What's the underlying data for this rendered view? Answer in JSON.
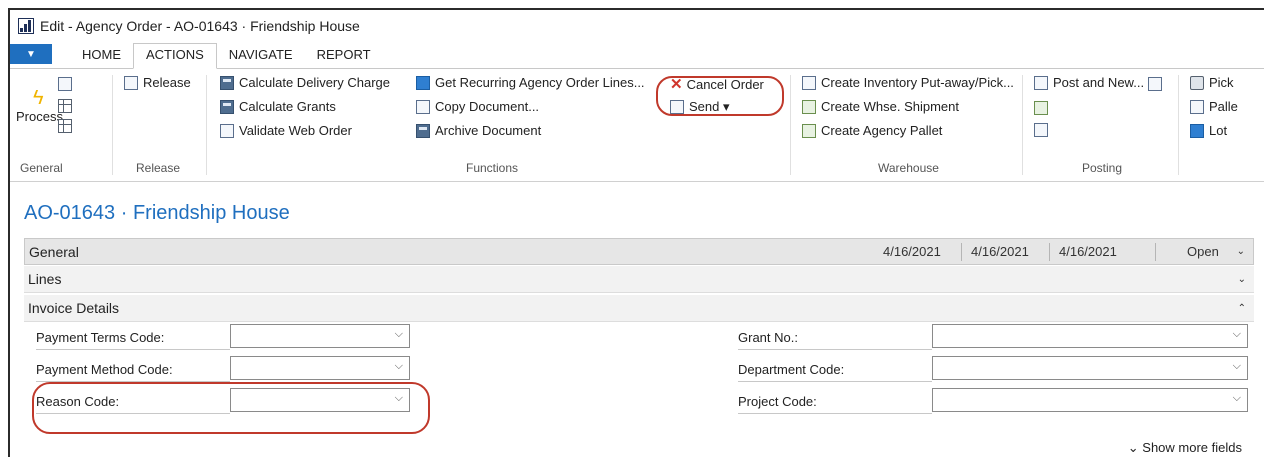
{
  "window": {
    "title": "Edit - Agency Order - AO-01643 · Friendship House"
  },
  "tabs": [
    "HOME",
    "ACTIONS",
    "NAVIGATE",
    "REPORT"
  ],
  "ribbon": {
    "general": {
      "process": "Process",
      "group": "General"
    },
    "release": {
      "release": "Release",
      "group": "Release"
    },
    "functions": {
      "calc_delivery": "Calculate Delivery Charge",
      "calc_grants": "Calculate Grants",
      "validate_web": "Validate Web Order",
      "get_recurring": "Get Recurring Agency Order Lines...",
      "copy_doc": "Copy Document...",
      "archive_doc": "Archive Document",
      "group": "Functions"
    },
    "cancel": {
      "cancel_order": "Cancel Order",
      "send": "Send ▾"
    },
    "warehouse": {
      "put_away": "Create Inventory Put-away/Pick...",
      "whse_shipment": "Create Whse. Shipment",
      "agency_pallet": "Create Agency Pallet",
      "group": "Warehouse"
    },
    "posting": {
      "post_new": "Post and New...",
      "group": "Posting"
    },
    "cut": {
      "pick": "Pick",
      "pallet": "Palle",
      "lot": "Lot"
    }
  },
  "page": {
    "title": "AO-01643 · Friendship House",
    "general": {
      "label": "General",
      "date1": "4/16/2021",
      "date2": "4/16/2021",
      "date3": "4/16/2021",
      "status": "Open"
    },
    "lines": {
      "label": "Lines"
    },
    "invoice": {
      "label": "Invoice Details"
    }
  },
  "fields": {
    "payment_terms": {
      "label": "Payment Terms Code:",
      "value": ""
    },
    "payment_method": {
      "label": "Payment Method Code:",
      "value": ""
    },
    "reason_code": {
      "label": "Reason Code:",
      "value": ""
    },
    "grant_no": {
      "label": "Grant No.:",
      "value": ""
    },
    "department": {
      "label": "Department Code:",
      "value": ""
    },
    "project": {
      "label": "Project Code:",
      "value": ""
    }
  },
  "show_more": "Show more fields",
  "colors": {
    "accent": "#1f6fbf",
    "highlight": "#c0392b",
    "cancel_icon": "#d0352c"
  }
}
